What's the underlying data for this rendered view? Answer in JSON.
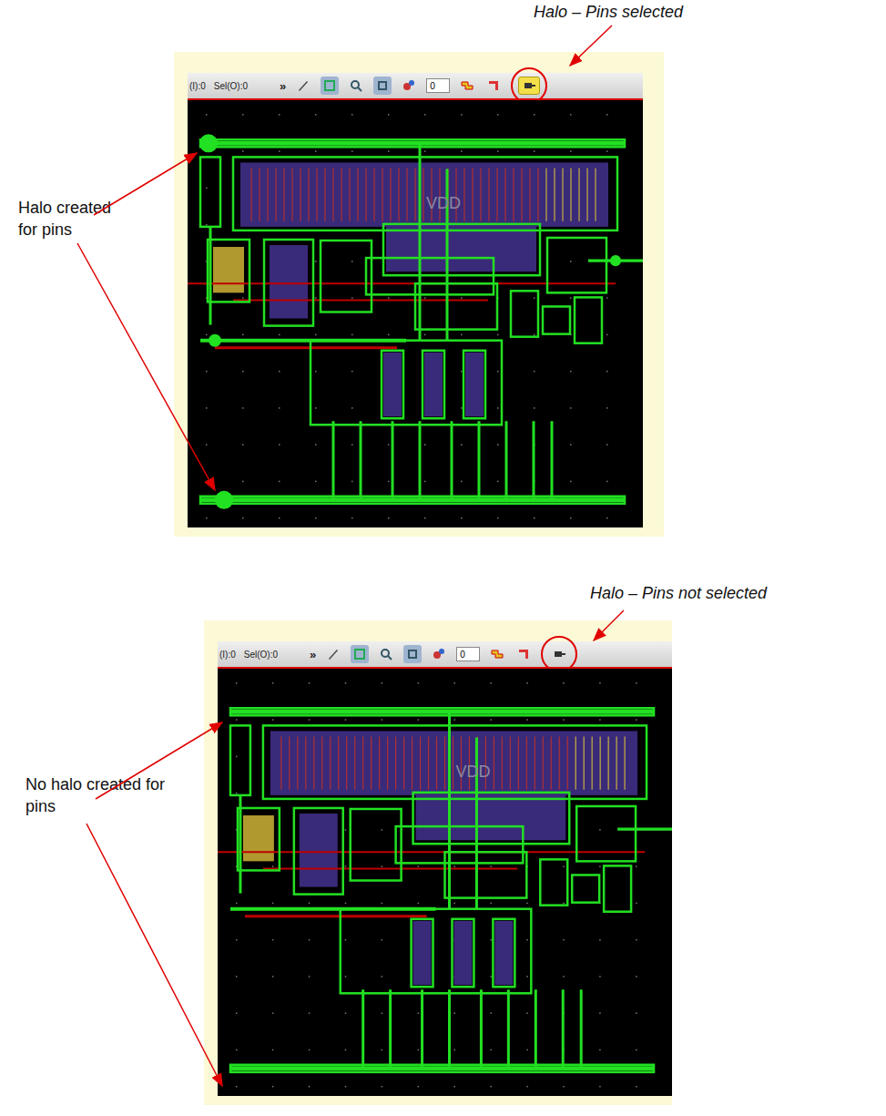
{
  "figures": [
    {
      "caption": "Halo – Pins selected",
      "callout": "Halo created for pins",
      "halo_pins_selected": true,
      "toolbar": {
        "selection_in": "(I):0",
        "selection_out": "Sel(O):0",
        "overflow": "»",
        "value": "0"
      },
      "layout_label": "VDD"
    },
    {
      "caption": "Halo – Pins not selected",
      "callout": "No halo created for pins",
      "halo_pins_selected": false,
      "toolbar": {
        "selection_in": "(I):0",
        "selection_out": "Sel(O):0",
        "overflow": "»",
        "value": "0"
      },
      "layout_label": "VDD"
    }
  ]
}
